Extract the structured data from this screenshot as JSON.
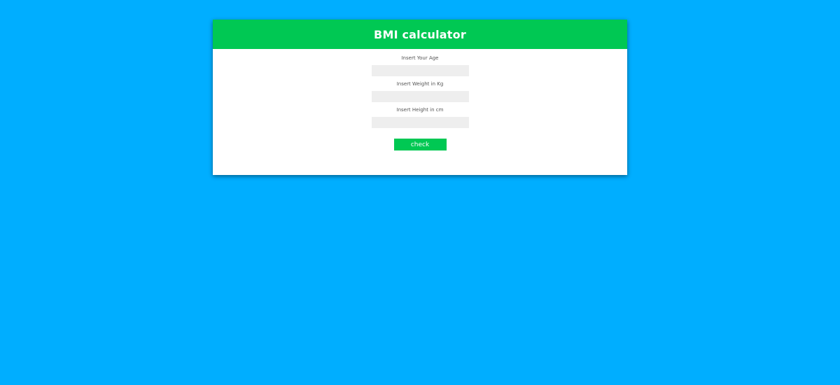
{
  "app": {
    "title": "BMI calculator"
  },
  "form": {
    "age_label": "Insert Your Age",
    "age_value": "",
    "weight_label": "Insert Weight in Kg",
    "weight_value": "",
    "height_label": "Insert Height in cm",
    "height_value": "",
    "submit_label": "check"
  },
  "colors": {
    "page_background": "#00aeff",
    "accent": "#00c853",
    "card_background": "#ffffff",
    "input_background": "#eeeeee"
  }
}
